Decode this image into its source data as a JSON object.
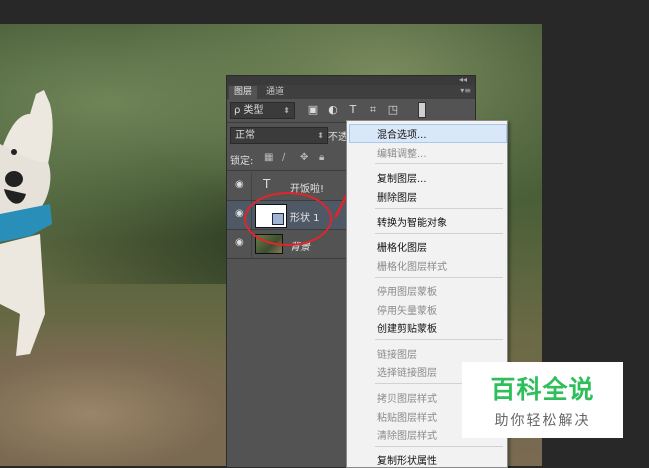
{
  "layers_panel": {
    "tabs": [
      "图层",
      "通道"
    ],
    "filter_label": "ρ 类型",
    "blend_mode": "正常",
    "opacity_label": "不透",
    "lock_label": "锁定:",
    "layers": [
      {
        "name": "开饭啦!",
        "type": "text"
      },
      {
        "name": "形状 1",
        "type": "shape",
        "selected": true
      },
      {
        "name": "背景",
        "type": "background"
      }
    ]
  },
  "context_menu": {
    "items": [
      {
        "label": "混合选项...",
        "enabled": true,
        "highlighted": true
      },
      {
        "label": "编辑调整...",
        "enabled": false
      },
      {
        "label": "复制图层...",
        "enabled": true
      },
      {
        "label": "删除图层",
        "enabled": true
      },
      {
        "label": "转换为智能对象",
        "enabled": true
      },
      {
        "label": "栅格化图层",
        "enabled": true
      },
      {
        "label": "栅格化图层样式",
        "enabled": false
      },
      {
        "label": "停用图层蒙板",
        "enabled": false
      },
      {
        "label": "停用矢量蒙板",
        "enabled": false
      },
      {
        "label": "创建剪贴蒙板",
        "enabled": true
      },
      {
        "label": "链接图层",
        "enabled": false
      },
      {
        "label": "选择链接图层",
        "enabled": false
      },
      {
        "label": "拷贝图层样式",
        "enabled": false
      },
      {
        "label": "粘贴图层样式",
        "enabled": false
      },
      {
        "label": "清除图层样式",
        "enabled": false
      },
      {
        "label": "复制形状属性",
        "enabled": true
      }
    ]
  },
  "watermark": {
    "title": "百科全说",
    "subtitle": "助你轻松解决"
  },
  "colors": {
    "annotation_red": "#e0252b",
    "watermark_green": "#2fbf5a",
    "menu_highlight": "#d9e8f8"
  }
}
